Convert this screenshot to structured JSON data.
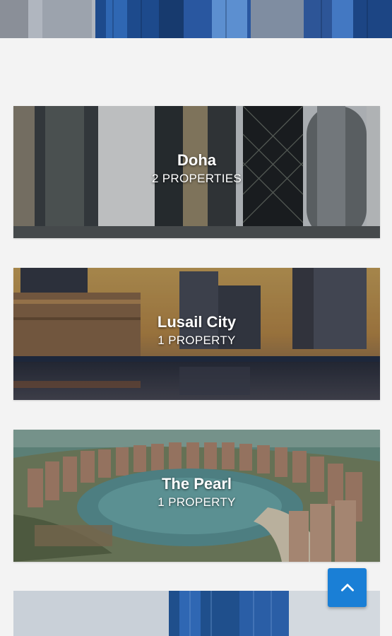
{
  "locations": [
    {
      "name": "Doha",
      "count": "2 PROPERTIES"
    },
    {
      "name": "Lusail City",
      "count": "1 PROPERTY"
    },
    {
      "name": "The Pearl",
      "count": "1 PROPERTY"
    }
  ],
  "scroll_top": {
    "icon": "chevron-up-icon",
    "color": "#1a7fd6"
  }
}
